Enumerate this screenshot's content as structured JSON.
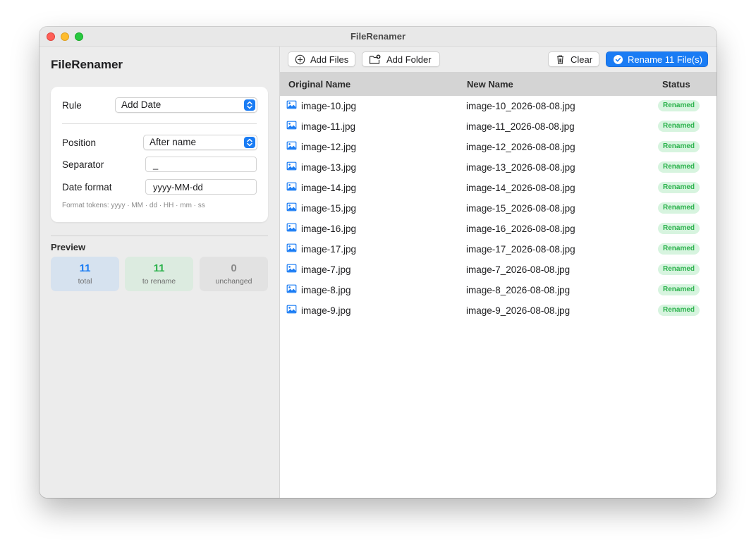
{
  "window": {
    "title": "FileRenamer"
  },
  "sidebar": {
    "app_title": "FileRenamer",
    "rule": {
      "label": "Rule",
      "value": "Add Date"
    },
    "position": {
      "label": "Position",
      "value": "After name"
    },
    "separator": {
      "label": "Separator",
      "value": "_"
    },
    "date_format": {
      "label": "Date format",
      "value": "yyyy-MM-dd"
    },
    "hint": "Format tokens: yyyy · MM · dd · HH · mm · ss",
    "preview": {
      "label": "Preview",
      "stats": [
        {
          "value": "11",
          "label": "total"
        },
        {
          "value": "11",
          "label": "to rename"
        },
        {
          "value": "0",
          "label": "unchanged"
        }
      ]
    }
  },
  "toolbar": {
    "add_files": "Add Files",
    "add_folder": "Add Folder",
    "clear": "Clear",
    "rename": "Rename 11 File(s)"
  },
  "table": {
    "columns": [
      "Original Name",
      "New Name",
      "Status"
    ],
    "rows": [
      {
        "original": "image-10.jpg",
        "new": "image-10_2026-08-08.jpg",
        "status": "Renamed"
      },
      {
        "original": "image-11.jpg",
        "new": "image-11_2026-08-08.jpg",
        "status": "Renamed"
      },
      {
        "original": "image-12.jpg",
        "new": "image-12_2026-08-08.jpg",
        "status": "Renamed"
      },
      {
        "original": "image-13.jpg",
        "new": "image-13_2026-08-08.jpg",
        "status": "Renamed"
      },
      {
        "original": "image-14.jpg",
        "new": "image-14_2026-08-08.jpg",
        "status": "Renamed"
      },
      {
        "original": "image-15.jpg",
        "new": "image-15_2026-08-08.jpg",
        "status": "Renamed"
      },
      {
        "original": "image-16.jpg",
        "new": "image-16_2026-08-08.jpg",
        "status": "Renamed"
      },
      {
        "original": "image-17.jpg",
        "new": "image-17_2026-08-08.jpg",
        "status": "Renamed"
      },
      {
        "original": "image-7.jpg",
        "new": "image-7_2026-08-08.jpg",
        "status": "Renamed"
      },
      {
        "original": "image-8.jpg",
        "new": "image-8_2026-08-08.jpg",
        "status": "Renamed"
      },
      {
        "original": "image-9.jpg",
        "new": "image-9_2026-08-08.jpg",
        "status": "Renamed"
      }
    ]
  },
  "colors": {
    "accent": "#1a7cf4",
    "status_green": "#2bb24c",
    "total_tile": "#d6e2ef",
    "rename_tile": "#dcebe0",
    "unchanged_tile": "#e2e2e2"
  },
  "icons": [
    "plus-circle-icon",
    "folder-badge-plus-icon",
    "trash-icon",
    "checkmark-circle-icon",
    "photo-icon",
    "chevron-up-down-icon"
  ]
}
